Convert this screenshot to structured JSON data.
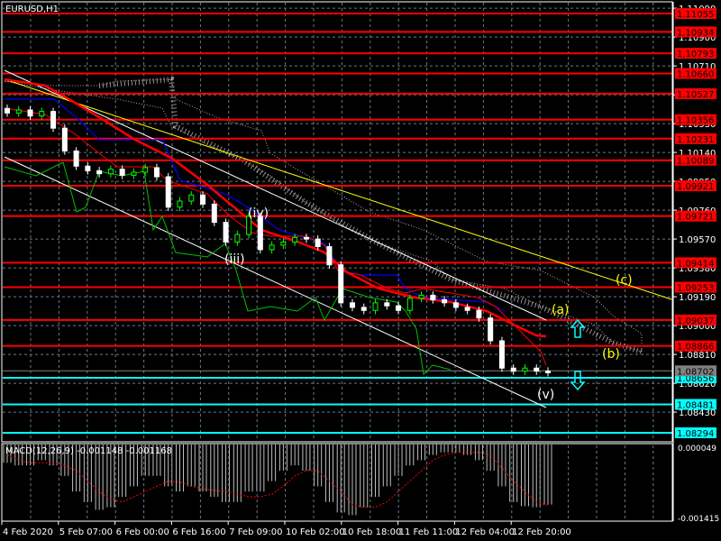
{
  "chart_data": {
    "type": "candlestick",
    "title": "EURUSD,H1",
    "symbol": "EURUSD",
    "timeframe": "H1",
    "ylim": [
      1.0823,
      1.1115
    ],
    "price_ticks": [
      "1.11090",
      "1.10900",
      "1.10710",
      "1.10520",
      "1.10330",
      "1.10140",
      "1.09950",
      "1.09760",
      "1.09570",
      "1.09380",
      "1.09190",
      "1.09000",
      "1.08810",
      "1.08620",
      "1.08430"
    ],
    "time_labels": [
      "4 Feb 2020",
      "5 Feb 07:00",
      "6 Feb 00:00",
      "6 Feb 16:00",
      "7 Feb 09:00",
      "10 Feb 02:00",
      "10 Feb 18:00",
      "11 Feb 11:00",
      "12 Feb 04:00",
      "12 Feb 20:00"
    ],
    "closes": [
      1.104,
      1.1042,
      1.1038,
      1.1041,
      1.103,
      1.1015,
      1.1005,
      1.1002,
      1.1,
      1.1003,
      1.0999,
      1.1001,
      1.1004,
      1.0998,
      1.0978,
      1.0982,
      1.0986,
      1.098,
      1.0968,
      1.0955,
      1.096,
      1.0972,
      1.095,
      1.0953,
      1.0955,
      1.0958,
      1.0957,
      1.0952,
      1.094,
      1.0915,
      1.0912,
      1.091,
      1.0915,
      1.0913,
      1.091,
      1.0918,
      1.092,
      1.0917,
      1.0915,
      1.0912,
      1.091,
      1.0905,
      1.089,
      1.0872,
      1.087,
      1.0872,
      1.087,
      1.0869
    ],
    "resistance_levels": [
      "1.11055",
      "1.10934",
      "1.10793",
      "1.10660",
      "1.10527",
      "1.10356",
      "1.10231",
      "1.10089",
      "1.09921",
      "1.09721",
      "1.09414",
      "1.09253",
      "1.09037",
      "1.08866"
    ],
    "support_levels": [
      "1.08656",
      "1.08481",
      "1.08294"
    ],
    "current_price": "1.08702",
    "wave_labels": {
      "iii": "(iii)",
      "iv": "(iv)",
      "v": "(v)",
      "a": "(a)",
      "b": "(b)",
      "c": "(c)"
    },
    "macd": {
      "label": "MACD(12,26,9) -0.001148 -0.001168",
      "max_label": "0.000049",
      "min_label": "-0.001415",
      "range": [
        -0.001415,
        4.9e-05
      ],
      "histogram": [
        -0.00035,
        -0.0004,
        -0.0004,
        -0.0003,
        -0.0004,
        -0.0006,
        -0.0009,
        -0.0011,
        -0.00125,
        -0.0012,
        -0.001,
        -0.0008,
        -0.0006,
        -0.0006,
        -0.0008,
        -0.0009,
        -0.0008,
        -0.0009,
        -0.001,
        -0.0011,
        -0.0011,
        -0.0009,
        -0.0009,
        -0.0007,
        -0.0005,
        -0.0004,
        -0.0005,
        -0.0008,
        -0.0011,
        -0.0013,
        -0.00135,
        -0.0012,
        -0.001,
        -0.0008,
        -0.0006,
        -0.0004,
        -0.0003,
        -0.0002,
        -0.00015,
        -0.00015,
        -0.0002,
        -0.0003,
        -0.0005,
        -0.0008,
        -0.0011,
        -0.00118,
        -0.0012,
        -0.00115
      ],
      "signal": [
        -0.0002,
        -0.0003,
        -0.00035,
        -0.00035,
        -0.00035,
        -0.0004,
        -0.0005,
        -0.0007,
        -0.0009,
        -0.00105,
        -0.0011,
        -0.001,
        -0.0009,
        -0.0008,
        -0.0007,
        -0.00072,
        -0.0008,
        -0.00085,
        -0.00088,
        -0.0009,
        -0.00095,
        -0.001,
        -0.001,
        -0.00095,
        -0.0008,
        -0.0006,
        -0.0005,
        -0.0005,
        -0.0007,
        -0.0009,
        -0.00115,
        -0.0012,
        -0.0012,
        -0.0011,
        -0.0009,
        -0.0007,
        -0.0005,
        -0.0003,
        -0.0002,
        -0.00015,
        -0.00015,
        -0.00015,
        -0.0002,
        -0.00045,
        -0.0007,
        -0.0009,
        -0.0011,
        -0.00117
      ]
    },
    "colors": {
      "bull": "#00ff00",
      "bear": "#ffffff",
      "resistance": "#ff0000",
      "support": "#00ffff",
      "trend": "#ffff00",
      "ma_slow": "#ff0000",
      "kijun": "#0000ff",
      "chikou": "#00c000",
      "price_bg": "#808080"
    }
  }
}
